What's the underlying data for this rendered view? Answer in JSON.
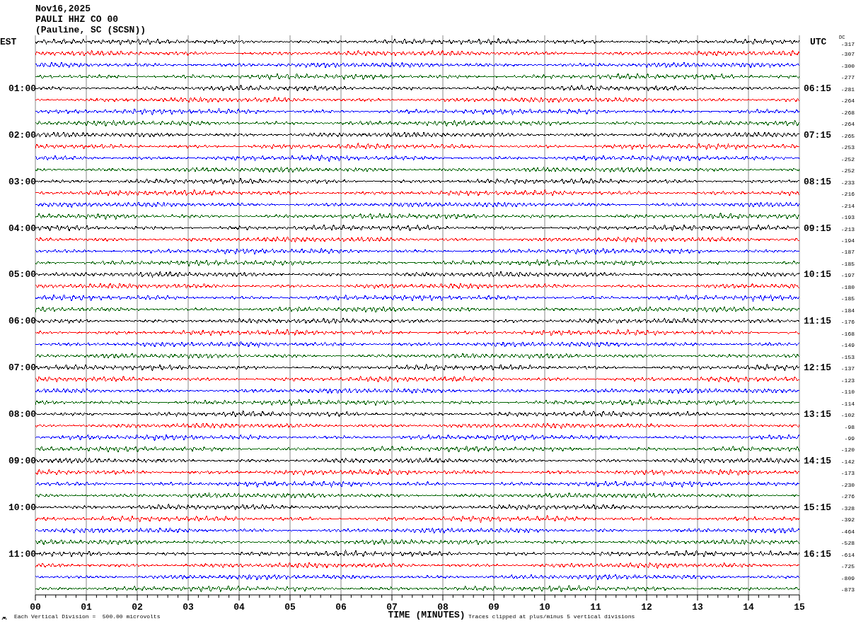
{
  "header": {
    "date": "Nov16,2025",
    "station": "PAULI HHZ CO 00",
    "location": "(Pauline, SC (SCSN))"
  },
  "left_axis": {
    "title": "EST",
    "labels": [
      "01:00",
      "02:00",
      "03:00",
      "04:00",
      "05:00",
      "06:00",
      "07:00",
      "08:00",
      "09:00",
      "10:00",
      "11:00"
    ]
  },
  "right_axis": {
    "title": "UTC",
    "dc_title": "DC",
    "labels": [
      "06:15",
      "07:15",
      "08:15",
      "09:15",
      "10:15",
      "11:15",
      "12:15",
      "13:15",
      "14:15",
      "15:15",
      "16:15"
    ]
  },
  "traces": [
    {
      "color": "#000000",
      "dc": "-317"
    },
    {
      "color": "#ff0000",
      "dc": "-307"
    },
    {
      "color": "#0000ff",
      "dc": "-300"
    },
    {
      "color": "#006400",
      "dc": "-277"
    },
    {
      "color": "#000000",
      "dc": "-281"
    },
    {
      "color": "#ff0000",
      "dc": "-264"
    },
    {
      "color": "#0000ff",
      "dc": "-268"
    },
    {
      "color": "#006400",
      "dc": "-264"
    },
    {
      "color": "#000000",
      "dc": "-265"
    },
    {
      "color": "#ff0000",
      "dc": "-253"
    },
    {
      "color": "#0000ff",
      "dc": "-252"
    },
    {
      "color": "#006400",
      "dc": "-252"
    },
    {
      "color": "#000000",
      "dc": "-233"
    },
    {
      "color": "#ff0000",
      "dc": "-216"
    },
    {
      "color": "#0000ff",
      "dc": "-214"
    },
    {
      "color": "#006400",
      "dc": "-193"
    },
    {
      "color": "#000000",
      "dc": "-213"
    },
    {
      "color": "#ff0000",
      "dc": "-194"
    },
    {
      "color": "#0000ff",
      "dc": "-187"
    },
    {
      "color": "#006400",
      "dc": "-185"
    },
    {
      "color": "#000000",
      "dc": "-197"
    },
    {
      "color": "#ff0000",
      "dc": "-180"
    },
    {
      "color": "#0000ff",
      "dc": "-185"
    },
    {
      "color": "#006400",
      "dc": "-184"
    },
    {
      "color": "#000000",
      "dc": "-176"
    },
    {
      "color": "#ff0000",
      "dc": "-168"
    },
    {
      "color": "#0000ff",
      "dc": "-149"
    },
    {
      "color": "#006400",
      "dc": "-153"
    },
    {
      "color": "#000000",
      "dc": "-137"
    },
    {
      "color": "#ff0000",
      "dc": "-123"
    },
    {
      "color": "#0000ff",
      "dc": "-110"
    },
    {
      "color": "#006400",
      "dc": "-114"
    },
    {
      "color": "#000000",
      "dc": "-102"
    },
    {
      "color": "#ff0000",
      "dc": "-98"
    },
    {
      "color": "#0000ff",
      "dc": "-99"
    },
    {
      "color": "#006400",
      "dc": "-120"
    },
    {
      "color": "#000000",
      "dc": "-142"
    },
    {
      "color": "#ff0000",
      "dc": "-173"
    },
    {
      "color": "#0000ff",
      "dc": "-230"
    },
    {
      "color": "#006400",
      "dc": "-276"
    },
    {
      "color": "#000000",
      "dc": "-328"
    },
    {
      "color": "#ff0000",
      "dc": "-392"
    },
    {
      "color": "#0000ff",
      "dc": "-464"
    },
    {
      "color": "#006400",
      "dc": "-528"
    },
    {
      "color": "#000000",
      "dc": "-614"
    },
    {
      "color": "#ff0000",
      "dc": "-725"
    },
    {
      "color": "#0000ff",
      "dc": "-809"
    },
    {
      "color": "#006400",
      "dc": "-873"
    }
  ],
  "x_axis": {
    "title": "TIME (MINUTES)",
    "ticks": [
      "00",
      "01",
      "02",
      "03",
      "04",
      "05",
      "06",
      "07",
      "08",
      "09",
      "10",
      "11",
      "12",
      "13",
      "14",
      "15"
    ]
  },
  "footer": {
    "scale": "Each Vertical Division =  500.00 microvolts",
    "clip_note": "Traces clipped at plus/minus 5 vertical divisions"
  }
}
